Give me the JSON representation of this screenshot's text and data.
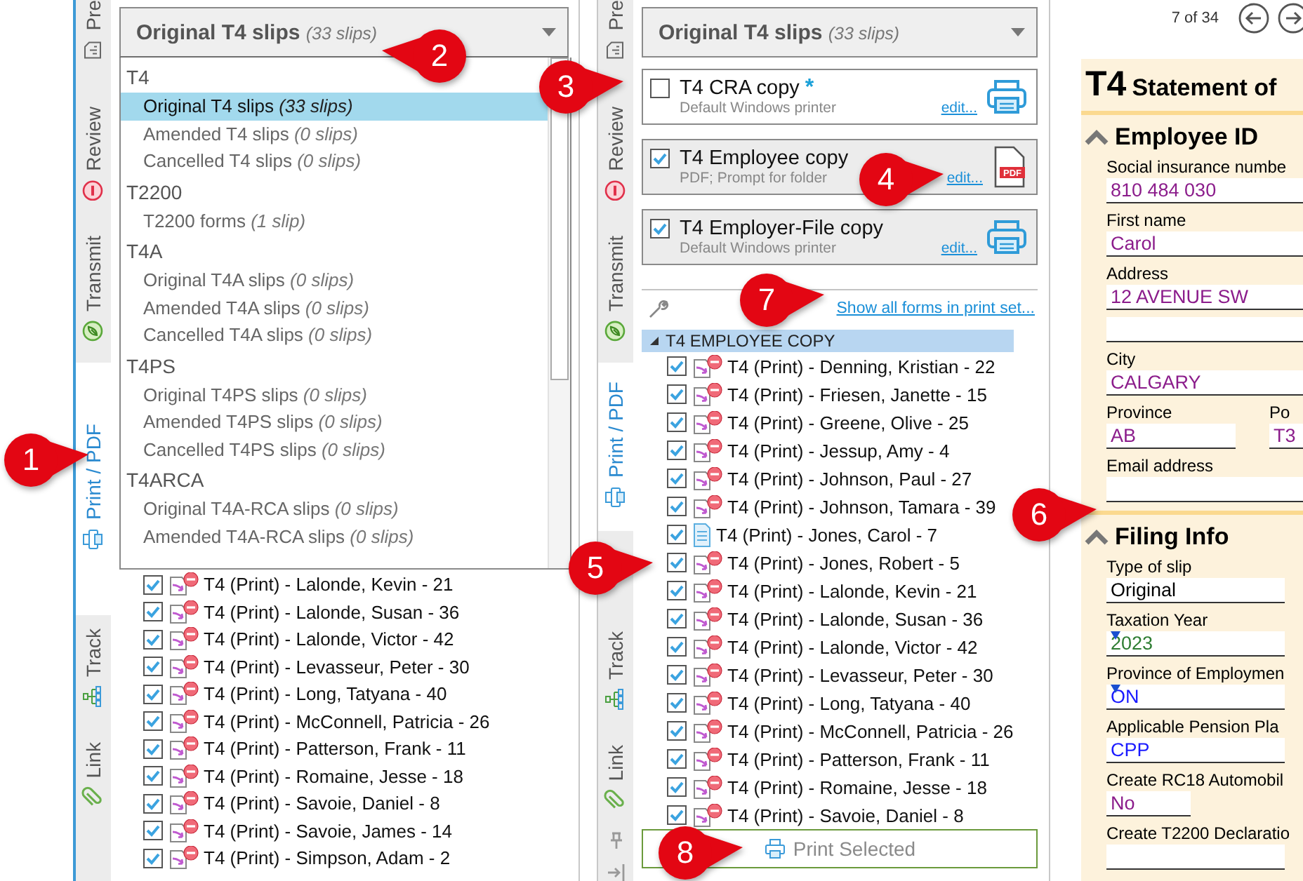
{
  "left_panel": {
    "tabs": [
      {
        "label": "Pre",
        "kind": "prep",
        "selected": false
      },
      {
        "label": "Review",
        "kind": "review",
        "selected": false
      },
      {
        "label": "Transmit",
        "kind": "transmit",
        "selected": false
      },
      {
        "label": "Print / PDF",
        "kind": "print",
        "selected": true
      },
      {
        "label": "Track",
        "kind": "track",
        "selected": false
      },
      {
        "label": "Link",
        "kind": "link",
        "selected": false
      }
    ],
    "dropdown": {
      "label": "Original T4 slips",
      "count": "(33 slips)",
      "expanded": true,
      "groups": [
        {
          "name": "T4",
          "items": [
            {
              "label": "Original T4 slips",
              "count": "(33 slips)",
              "selected": true
            },
            {
              "label": "Amended T4 slips",
              "count": "(0 slips)",
              "selected": false
            },
            {
              "label": "Cancelled T4 slips",
              "count": "(0 slips)",
              "selected": false
            }
          ]
        },
        {
          "name": "T2200",
          "items": [
            {
              "label": "T2200 forms",
              "count": "(1 slip)",
              "selected": false
            }
          ]
        },
        {
          "name": "T4A",
          "items": [
            {
              "label": "Original T4A slips",
              "count": "(0 slips)",
              "selected": false
            },
            {
              "label": "Amended T4A slips",
              "count": "(0 slips)",
              "selected": false
            },
            {
              "label": "Cancelled T4A slips",
              "count": "(0 slips)",
              "selected": false
            }
          ]
        },
        {
          "name": "T4PS",
          "items": [
            {
              "label": "Original T4PS slips",
              "count": "(0 slips)",
              "selected": false
            },
            {
              "label": "Amended T4PS slips",
              "count": "(0 slips)",
              "selected": false
            },
            {
              "label": "Cancelled T4PS slips",
              "count": "(0 slips)",
              "selected": false
            }
          ]
        },
        {
          "name": "T4ARCA",
          "items": [
            {
              "label": "Original T4A-RCA slips",
              "count": "(0 slips)",
              "selected": false
            },
            {
              "label": "Amended T4A-RCA slips",
              "count": "(0 slips)",
              "selected": false
            }
          ]
        }
      ]
    },
    "rows": [
      {
        "text": "T4 (Print) - Lalonde, Kevin - 21",
        "checked": true,
        "kind": "print-error"
      },
      {
        "text": "T4 (Print) - Lalonde, Susan - 36",
        "checked": true,
        "kind": "print-error"
      },
      {
        "text": "T4 (Print) - Lalonde, Victor - 42",
        "checked": true,
        "kind": "print-error"
      },
      {
        "text": "T4 (Print) - Levasseur, Peter - 30",
        "checked": true,
        "kind": "print-error"
      },
      {
        "text": "T4 (Print) - Long, Tatyana - 40",
        "checked": true,
        "kind": "print-error"
      },
      {
        "text": "T4 (Print) - McConnell, Patricia - 26",
        "checked": true,
        "kind": "print-error"
      },
      {
        "text": "T4 (Print) - Patterson, Frank - 11",
        "checked": true,
        "kind": "print-error"
      },
      {
        "text": "T4 (Print) - Romaine, Jesse - 18",
        "checked": true,
        "kind": "print-error"
      },
      {
        "text": "T4 (Print) - Savoie, Daniel - 8",
        "checked": true,
        "kind": "print-error"
      },
      {
        "text": "T4 (Print) - Savoie, James - 14",
        "checked": true,
        "kind": "print-error"
      },
      {
        "text": "T4 (Print) - Simpson, Adam - 2",
        "checked": true,
        "kind": "print-error"
      }
    ]
  },
  "middle_panel": {
    "tabs": [
      {
        "label": "Pre",
        "kind": "prep",
        "selected": false
      },
      {
        "label": "Review",
        "kind": "review",
        "selected": false
      },
      {
        "label": "Transmit",
        "kind": "transmit",
        "selected": false
      },
      {
        "label": "Print / PDF",
        "kind": "print",
        "selected": true
      },
      {
        "label": "Track",
        "kind": "track",
        "selected": false
      },
      {
        "label": "Link",
        "kind": "link",
        "selected": false
      }
    ],
    "dropdown": {
      "label": "Original T4 slips",
      "count": "(33 slips)",
      "expanded": false
    },
    "copies": [
      {
        "title": "T4 CRA copy",
        "marker": "*",
        "subtitle": "Default Windows printer",
        "edit": "edit...",
        "checked": false,
        "kind": "printer"
      },
      {
        "title": "T4 Employee copy",
        "subtitle": "PDF; Prompt for folder",
        "edit": "edit...",
        "checked": true,
        "kind": "pdf",
        "device_label": "PDF"
      },
      {
        "title": "T4 Employer-File copy",
        "subtitle": "Default Windows printer",
        "edit": "edit...",
        "checked": true,
        "kind": "printer"
      }
    ],
    "tools_link": "Show all forms in print set...",
    "tree": {
      "label": "T4 EMPLOYEE COPY",
      "expanded": true,
      "children": [
        {
          "text": "T4 (Print) - Denning, Kristian - 22",
          "checked": true,
          "kind": "print-error"
        },
        {
          "text": "T4 (Print) - Friesen, Janette - 15",
          "checked": true,
          "kind": "print-error"
        },
        {
          "text": "T4 (Print) - Greene, Olive - 25",
          "checked": true,
          "kind": "print-error"
        },
        {
          "text": "T4 (Print) - Jessup, Amy - 4",
          "checked": true,
          "kind": "print-error"
        },
        {
          "text": "T4 (Print) - Johnson, Paul - 27",
          "checked": true,
          "kind": "print-error"
        },
        {
          "text": "T4 (Print) - Johnson, Tamara - 39",
          "checked": true,
          "kind": "print-error"
        },
        {
          "text": "T4 (Print) - Jones, Carol - 7",
          "checked": true,
          "kind": "document"
        },
        {
          "text": "T4 (Print) - Jones, Robert - 5",
          "checked": true,
          "kind": "print-error"
        },
        {
          "text": "T4 (Print) - Lalonde, Kevin - 21",
          "checked": true,
          "kind": "print-error"
        },
        {
          "text": "T4 (Print) - Lalonde, Susan - 36",
          "checked": true,
          "kind": "print-error"
        },
        {
          "text": "T4 (Print) - Lalonde, Victor - 42",
          "checked": true,
          "kind": "print-error"
        },
        {
          "text": "T4 (Print) - Levasseur, Peter - 30",
          "checked": true,
          "kind": "print-error"
        },
        {
          "text": "T4 (Print) - Long, Tatyana - 40",
          "checked": true,
          "kind": "print-error"
        },
        {
          "text": "T4 (Print) - McConnell, Patricia - 26",
          "checked": true,
          "kind": "print-error"
        },
        {
          "text": "T4 (Print) - Patterson, Frank - 11",
          "checked": true,
          "kind": "print-error"
        },
        {
          "text": "T4 (Print) - Romaine, Jesse - 18",
          "checked": true,
          "kind": "print-error"
        },
        {
          "text": "T4 (Print) - Savoie, Daniel - 8",
          "checked": true,
          "kind": "print-error"
        }
      ]
    },
    "print_button": {
      "label": "Print Selected",
      "disabled": true
    }
  },
  "form_panel": {
    "pager": "7 of 34",
    "title": "T4",
    "subtitle": "Statement of",
    "sections": [
      {
        "title": "Employee ID",
        "expanded": true,
        "rows": [
          {
            "fields": [
              {
                "label": "Social insurance numbe",
                "value": "810 484 030",
                "kind": "wide",
                "color": "#8b1c8b"
              }
            ]
          },
          {
            "fields": [
              {
                "label": "First name",
                "value": "Carol",
                "kind": "wide",
                "color": "#8b1c8b"
              }
            ]
          },
          {
            "fields": [
              {
                "label": "Address",
                "value": "12 AVENUE SW",
                "kind": "wide",
                "color": "#8b1c8b"
              }
            ]
          },
          {
            "fields": [
              {
                "kind": "wide"
              }
            ]
          },
          {
            "fields": [
              {
                "label": "City",
                "value": "CALGARY",
                "kind": "wide",
                "color": "#8b1c8b"
              }
            ]
          },
          {
            "fields": [
              {
                "label": "Province",
                "value": "AB",
                "kind": "half",
                "color": "#8b1c8b"
              },
              {
                "label": "Po",
                "value": "T3",
                "kind": "wide",
                "color": "#8b1c8b"
              }
            ]
          },
          {
            "fields": [
              {
                "label": "Email address",
                "kind": "wide"
              }
            ]
          }
        ]
      },
      {
        "title": "Filing Info",
        "expanded": true,
        "rows": [
          {
            "fields": [
              {
                "label": "Type of slip",
                "value": "Original",
                "kind": "medium",
                "color": "#000000"
              }
            ]
          },
          {
            "fields": [
              {
                "label": "Taxation Year",
                "value": "2023",
                "kind": "medium",
                "color": "#2e7d32",
                "flag": true
              }
            ]
          },
          {
            "fields": [
              {
                "label": "Province of Employmen",
                "value": "ON",
                "kind": "medium",
                "color": "#1a1aff",
                "flag": true
              }
            ]
          },
          {
            "fields": [
              {
                "label": "Applicable Pension Pla",
                "value": "CPP",
                "kind": "medium",
                "color": "#1a1aff"
              }
            ]
          },
          {
            "fields": [
              {
                "label": "Create RC18 Automobil",
                "value": "No",
                "kind": "short",
                "color": "#8b1c8b"
              }
            ]
          },
          {
            "fields": [
              {
                "label": "Create T2200 Declaratio",
                "kind": "medium"
              }
            ]
          }
        ]
      }
    ]
  },
  "callouts": [
    {
      "number": "1",
      "kind": "right"
    },
    {
      "number": "2",
      "kind": "left"
    },
    {
      "number": "3",
      "kind": "right"
    },
    {
      "number": "4",
      "kind": "right"
    },
    {
      "number": "5",
      "kind": "right"
    },
    {
      "number": "6",
      "kind": "right"
    },
    {
      "number": "7",
      "kind": "right"
    },
    {
      "number": "8",
      "kind": "right"
    }
  ]
}
